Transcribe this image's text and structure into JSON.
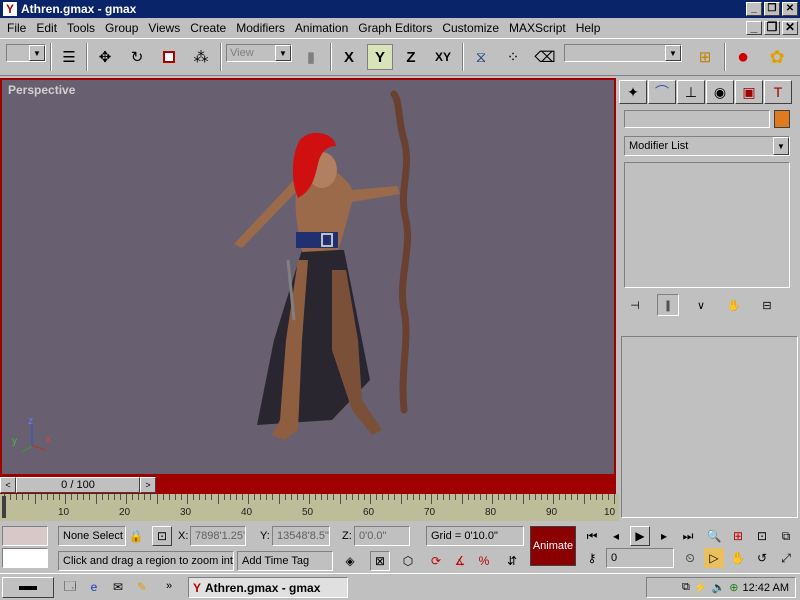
{
  "window": {
    "title": "Athren.gmax - gmax",
    "app_icon": "gmax-logo-icon",
    "controls": [
      "_",
      "❐",
      "✕"
    ]
  },
  "menu": {
    "items": [
      "File",
      "Edit",
      "Tools",
      "Group",
      "Views",
      "Create",
      "Modifiers",
      "Animation",
      "Graph Editors",
      "Customize",
      "MAXScript",
      "Help"
    ],
    "mdi_controls": [
      "_",
      "❐",
      "✕"
    ]
  },
  "toolbar": {
    "view_dropdown": "View",
    "axis_x": "X",
    "axis_y": "Y",
    "axis_z": "Z",
    "axis_xy": "XY",
    "selection_set": ""
  },
  "viewport": {
    "label": "Perspective",
    "axis_labels": {
      "x": "x",
      "y": "y",
      "z": "z"
    }
  },
  "command_panel": {
    "tabs": [
      "create-icon",
      "modify-icon",
      "hierarchy-icon",
      "motion-icon",
      "display-icon",
      "utilities-icon"
    ],
    "object_name": "",
    "object_color": "#e07a1e",
    "modifier_list": "Modifier List"
  },
  "timeline": {
    "frame_display": "0 / 100",
    "prev": "<",
    "next": ">",
    "ticks": [
      "10",
      "20",
      "30",
      "40",
      "50",
      "60",
      "70",
      "80",
      "90",
      "10"
    ]
  },
  "status": {
    "selection": "None Select",
    "x_label": "X:",
    "x_value": "7898'1.25\"",
    "y_label": "Y:",
    "y_value": "13548'8.5\"",
    "z_label": "Z:",
    "z_value": "0'0.0\"",
    "grid": "Grid = 0'10.0\"",
    "prompt": "Click and drag a region to zoom into",
    "add_time_tag": "Add Time Tag",
    "animate": "Animate",
    "current_frame": "0"
  },
  "taskbar": {
    "task_label": "Athren.gmax - gmax",
    "clock": "12:42 AM",
    "quicklaunch_more": "»"
  }
}
